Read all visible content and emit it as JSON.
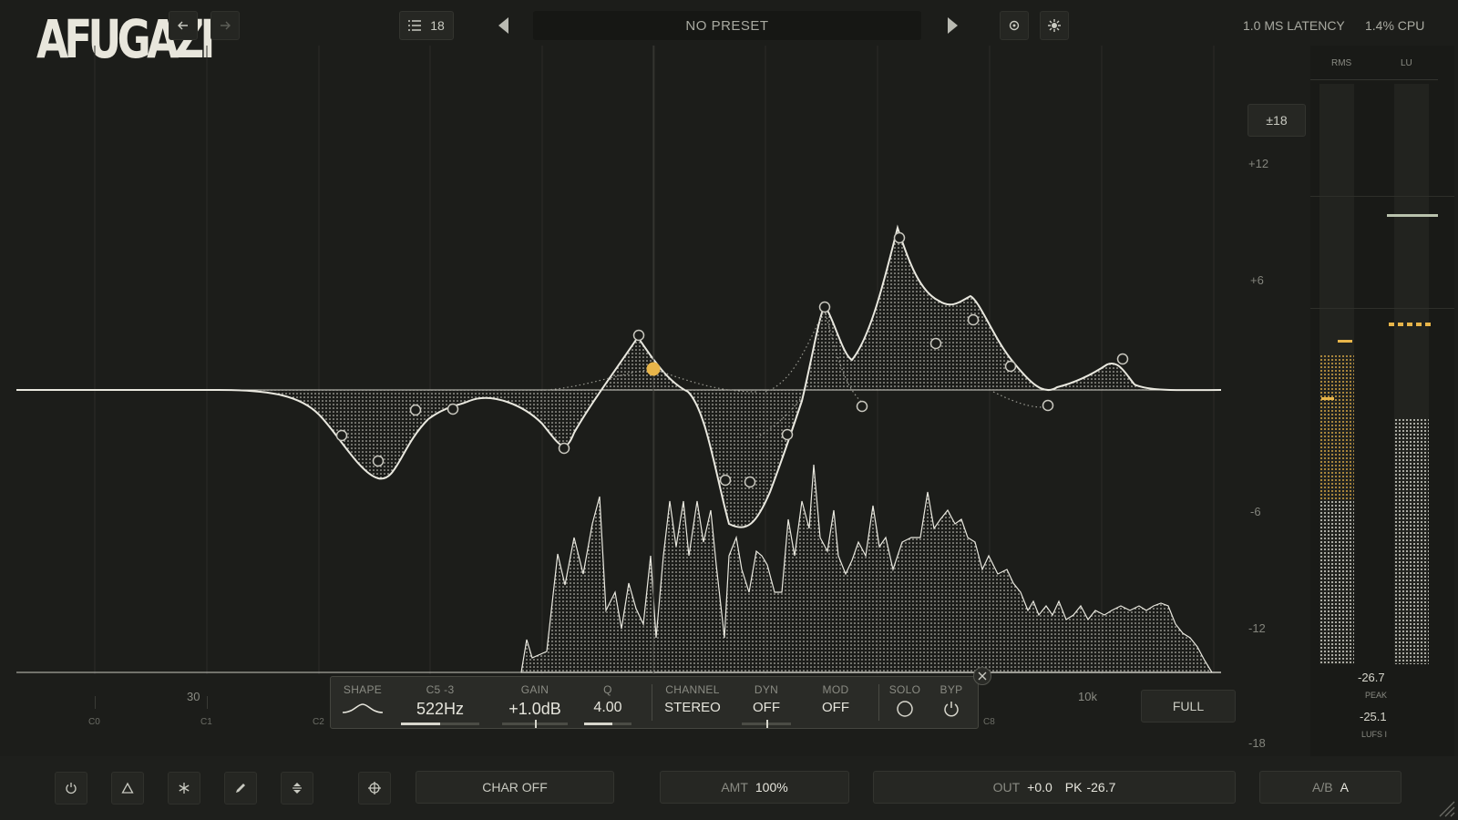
{
  "app": {
    "logo": "AFUGAZI"
  },
  "toolbar": {
    "preset_count": "18",
    "preset_name": "NO PRESET",
    "latency": "1.0 MS LATENCY",
    "cpu": "1.4% CPU"
  },
  "eq": {
    "range_button": "±18",
    "y_ticks": [
      "+12",
      "+6",
      "-6",
      "-12",
      "-18"
    ],
    "x_freq_labels": [
      "30",
      "10k"
    ],
    "note_labels": [
      "C0",
      "C1",
      "C2",
      "C8"
    ],
    "full_button": "FULL"
  },
  "band_panel": {
    "shape_label": "SHAPE",
    "note_label": "C5 -3",
    "freq_value": "522Hz",
    "gain_label": "GAIN",
    "gain_value": "+1.0dB",
    "q_label": "Q",
    "q_value": "4.00",
    "channel_label": "CHANNEL",
    "channel_value": "STEREO",
    "dyn_label": "DYN",
    "dyn_value": "OFF",
    "mod_label": "MOD",
    "mod_value": "OFF",
    "solo_label": "SOLO",
    "byp_label": "BYP"
  },
  "meters": {
    "rms_label": "RMS",
    "lu_label": "LU",
    "value_1": "-26.7",
    "peak_label": "PEAK",
    "value_2": "-25.1",
    "lufs_label": "LUFS I"
  },
  "footer": {
    "char_button": "CHAR OFF",
    "amt_label": "AMT",
    "amt_value": "100%",
    "out_label": "OUT",
    "out_value": "+0.0",
    "pk_label": "PK",
    "pk_value": "-26.7",
    "ab_label": "A/B",
    "ab_value": "A"
  },
  "colors": {
    "accent": "#e8b54a",
    "curve": "#e9e8df",
    "background": "#1c1d1a"
  },
  "icons": [
    "undo-icon",
    "redo-icon",
    "list-icon",
    "prev-preset-icon",
    "next-preset-icon",
    "settings-icon",
    "gear-icon",
    "power-icon",
    "triangle-icon",
    "asterisk-icon",
    "pencil-icon",
    "up-down-icon",
    "crosshair-icon",
    "close-icon",
    "bell-curve-icon"
  ]
}
